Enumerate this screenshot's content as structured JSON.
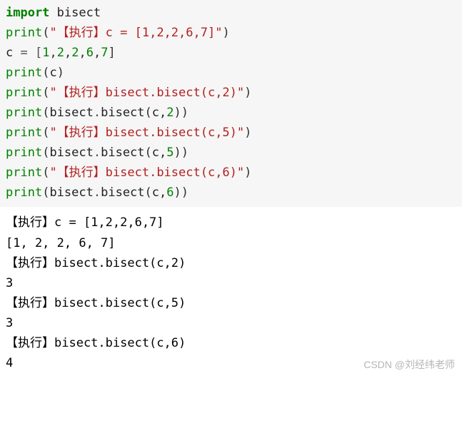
{
  "code": {
    "l1": {
      "kw": "import",
      "mod": " bisect"
    },
    "l2": {
      "fn": "print",
      "op1": "(",
      "str": "\"【执行】c = [1,2,2,6,7]\"",
      "op2": ")"
    },
    "l3": {
      "var": "c ",
      "op": "= [",
      "n1": "1",
      "c1": ",",
      "n2": "2",
      "c2": ",",
      "n3": "2",
      "c3": ",",
      "n4": "6",
      "c4": ",",
      "n5": "7",
      "cl": "]"
    },
    "l4": {
      "fn": "print",
      "op1": "(",
      "arg": "c",
      "op2": ")"
    },
    "l5": {
      "fn": "print",
      "op1": "(",
      "str": "\"【执行】bisect.bisect(c,2)\"",
      "op2": ")"
    },
    "l6": {
      "fn": "print",
      "op1": "(",
      "mod": "bisect",
      "dot": ".",
      "call": "bisect",
      "op2": "(",
      "arg": "c,",
      "num": "2",
      "op3": "))"
    },
    "l7": {
      "fn": "print",
      "op1": "(",
      "str": "\"【执行】bisect.bisect(c,5)\"",
      "op2": ")"
    },
    "l8": {
      "fn": "print",
      "op1": "(",
      "mod": "bisect",
      "dot": ".",
      "call": "bisect",
      "op2": "(",
      "arg": "c,",
      "num": "5",
      "op3": "))"
    },
    "l9": {
      "fn": "print",
      "op1": "(",
      "str": "\"【执行】bisect.bisect(c,6)\"",
      "op2": ")"
    },
    "l10": {
      "fn": "print",
      "op1": "(",
      "mod": "bisect",
      "dot": ".",
      "call": "bisect",
      "op2": "(",
      "arg": "c,",
      "num": "6",
      "op3": "))"
    }
  },
  "output": {
    "o1": "【执行】c = [1,2,2,6,7]",
    "o2": "[1, 2, 2, 6, 7]",
    "o3": "【执行】bisect.bisect(c,2)",
    "o4": "3",
    "o5": "【执行】bisect.bisect(c,5)",
    "o6": "3",
    "o7": "【执行】bisect.bisect(c,6)",
    "o8": "4"
  },
  "watermark": "CSDN @刘经纬老师"
}
